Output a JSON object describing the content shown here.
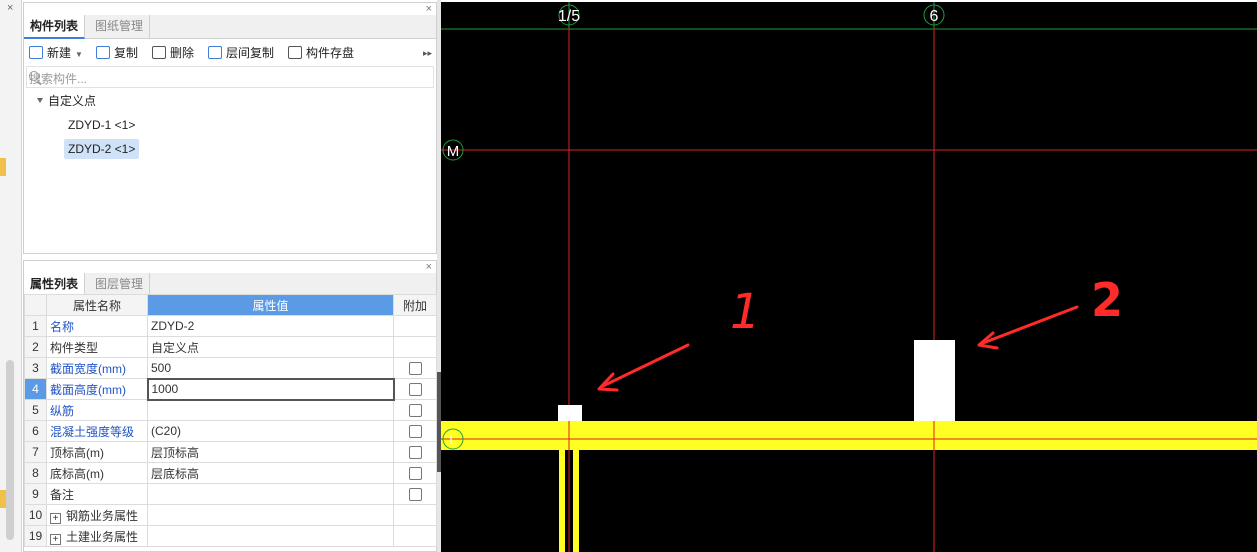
{
  "component_panel": {
    "tabs": [
      "构件列表",
      "图纸管理"
    ],
    "close_glyph": "×",
    "toolbar": {
      "new_label": "新建",
      "copy_label": "复制",
      "delete_label": "删除",
      "floor_copy_label": "层间复制",
      "save_label": "构件存盘"
    },
    "search_placeholder": "搜索构件...",
    "tree": {
      "group_label": "自定义点",
      "items": [
        "ZDYD-1 <1>",
        "ZDYD-2 <1>"
      ]
    }
  },
  "property_panel": {
    "tabs": [
      "属性列表",
      "图层管理"
    ],
    "headers": {
      "name": "属性名称",
      "value": "属性值",
      "extra": "附加"
    },
    "rows": [
      {
        "num": "1",
        "name": "名称",
        "value": "ZDYD-2"
      },
      {
        "num": "2",
        "name": "构件类型",
        "value": "自定义点"
      },
      {
        "num": "3",
        "name": "截面宽度(mm)",
        "value": "500"
      },
      {
        "num": "4",
        "name": "截面高度(mm)",
        "value": "1000"
      },
      {
        "num": "5",
        "name": "纵筋",
        "value": ""
      },
      {
        "num": "6",
        "name": "混凝土强度等级",
        "value": "(C20)"
      },
      {
        "num": "7",
        "name": "顶标高(m)",
        "value": "层顶标高"
      },
      {
        "num": "8",
        "name": "底标高(m)",
        "value": "层底标高"
      },
      {
        "num": "9",
        "name": "备注",
        "value": ""
      },
      {
        "num": "10",
        "name": "钢筋业务属性",
        "value": ""
      },
      {
        "num": "19",
        "name": "土建业务属性",
        "value": ""
      }
    ],
    "plus_glyph": "+"
  },
  "canvas": {
    "axis_labels": {
      "top_left": "1/5",
      "top_right": "6",
      "left_upper": "M",
      "left_lower": "L"
    },
    "annotations": [
      "1",
      "2"
    ],
    "colors": {
      "background": "#000000",
      "axis_red": "#e02020",
      "axis_green": "#1f9e3a",
      "beam_yellow": "#ffff22",
      "annotation_red": "#ff2a2a"
    }
  }
}
